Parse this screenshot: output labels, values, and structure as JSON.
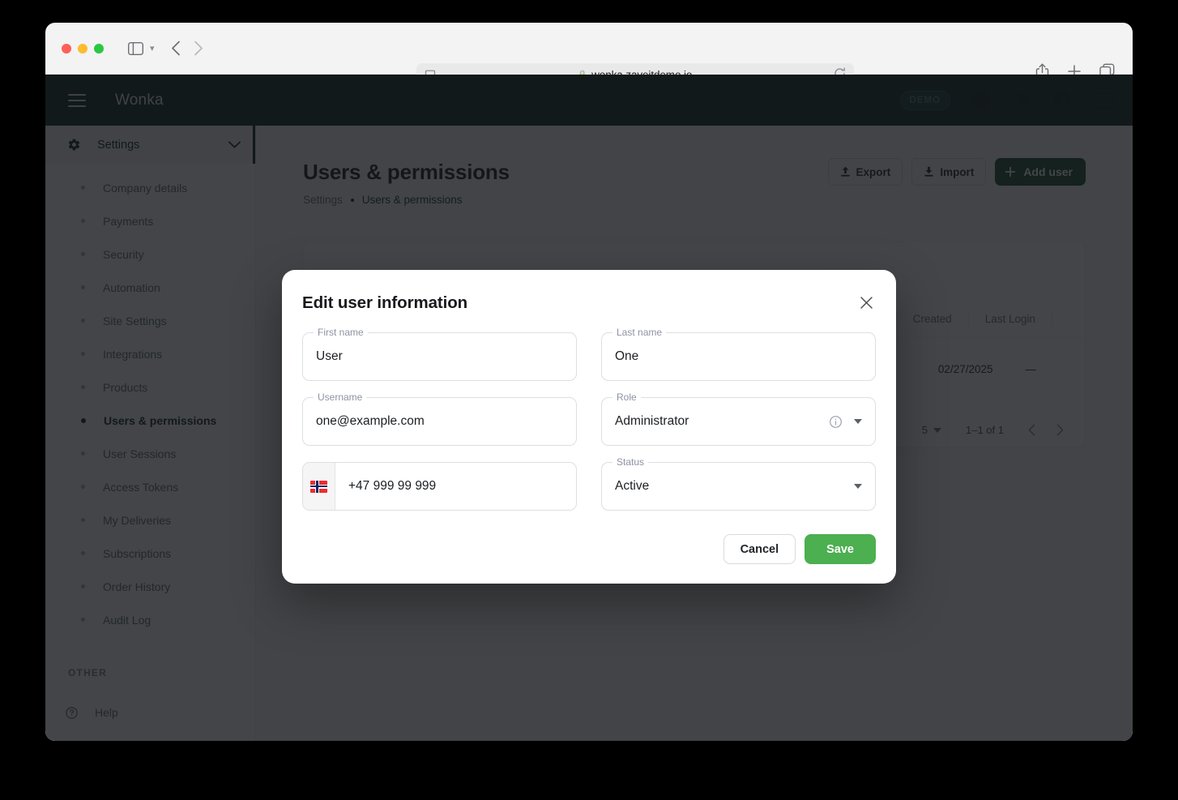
{
  "browser": {
    "url": "wonka.zaveitdemo.io",
    "lock_icon": "lock-icon",
    "reader_icon": "reader-view-icon",
    "reload_icon": "reload-icon",
    "sidebar_icon": "sidebar-toggle-icon",
    "back_icon": "nav-back-icon",
    "forward_icon": "nav-forward-icon",
    "share_icon": "share-icon",
    "new_tab_icon": "plus-icon",
    "tabs_icon": "tab-overview-icon"
  },
  "app_header": {
    "brand": "Wonka",
    "menu_icon": "hamburger-icon",
    "demo_badge": "DEMO",
    "help_icon": "question-mark-circle-icon",
    "notifications_icon": "bell-icon",
    "account_icon": "account-circle-icon",
    "panel_icon": "right-panel-icon"
  },
  "sidebar": {
    "group": {
      "label": "Settings",
      "icon": "gear-icon",
      "chevron": "chevron-down-icon"
    },
    "items": [
      {
        "label": "Company details",
        "active": false
      },
      {
        "label": "Payments",
        "active": false
      },
      {
        "label": "Security",
        "active": false
      },
      {
        "label": "Automation",
        "active": false
      },
      {
        "label": "Site Settings",
        "active": false
      },
      {
        "label": "Integrations",
        "active": false
      },
      {
        "label": "Products",
        "active": false
      },
      {
        "label": "Users & permissions",
        "active": true
      },
      {
        "label": "User Sessions",
        "active": false
      },
      {
        "label": "Access Tokens",
        "active": false
      },
      {
        "label": "My Deliveries",
        "active": false
      },
      {
        "label": "Subscriptions",
        "active": false
      },
      {
        "label": "Order History",
        "active": false
      },
      {
        "label": "Audit Log",
        "active": false
      }
    ],
    "other_section_label": "OTHER",
    "help": {
      "label": "Help",
      "icon": "question-mark-circle-icon"
    }
  },
  "main": {
    "title": "Users & permissions",
    "breadcrumb": {
      "root": "Settings",
      "current": "Users & permissions"
    },
    "actions": {
      "export_label": "Export",
      "export_icon": "upload-icon",
      "import_label": "Import",
      "import_icon": "download-icon",
      "add_user_label": "Add user",
      "add_user_icon": "plus-icon",
      "add_user_color": "#154d2e"
    },
    "table": {
      "columns": [
        "Created",
        "Last Login"
      ],
      "rows": [
        {
          "created": "02/27/2025",
          "last_login": "—"
        }
      ]
    },
    "pagination": {
      "rows_per_page": "5",
      "rows_per_page_caret": "chevron-down-icon",
      "range_label": "1–1 of 1",
      "prev_icon": "chevron-left-icon",
      "next_icon": "chevron-right-icon"
    }
  },
  "modal": {
    "title": "Edit user information",
    "close_icon": "close-icon",
    "fields": {
      "first_name": {
        "label": "First name",
        "value": "User"
      },
      "last_name": {
        "label": "Last name",
        "value": "One"
      },
      "username": {
        "label": "Username",
        "value": "one@example.com"
      },
      "role": {
        "label": "Role",
        "value": "Administrator",
        "info_icon": "info-icon",
        "caret_icon": "chevron-down-icon"
      },
      "phone": {
        "value": "+47 999 99 999",
        "country_flag": "norway-flag-icon"
      },
      "status": {
        "label": "Status",
        "value": "Active",
        "caret_icon": "chevron-down-icon"
      }
    },
    "footer": {
      "cancel_label": "Cancel",
      "save_label": "Save",
      "save_color": "#4caf50"
    }
  }
}
